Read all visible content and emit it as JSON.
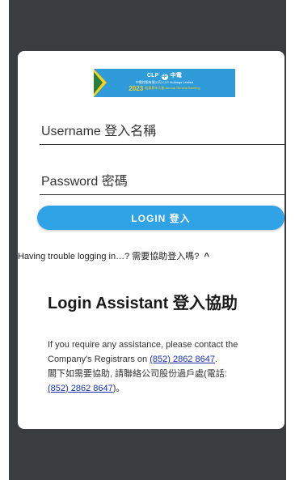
{
  "banner": {
    "brand": "CLP",
    "brand_symbol": "中",
    "brand_cn": "中電",
    "subtitle": "中電控股有限公司 CLP Holdings Limited",
    "year": "2023",
    "meeting": "股東周年大會 Annual General Meeting"
  },
  "form": {
    "username_placeholder": "Username 登入名稱",
    "password_placeholder": "Password 密碼",
    "login_label": "LOGIN 登入"
  },
  "help": {
    "trouble_text": "Having trouble logging in…? 需要協助登入嗎?",
    "toggle_icon": "chevron-up-icon",
    "toggle_glyph": "^"
  },
  "assistant": {
    "title": "Login Assistant 登入協助",
    "text_en": "If you require any assistance, please contact the Company's Registrars on ",
    "phone": "(852) 2862 8647",
    "text_en_end": ".",
    "text_cn": "閣下如需要協助, 請聯絡公司股份過戶處(電話: ",
    "text_cn_end": ")。"
  },
  "colors": {
    "background": "#3a3d3e",
    "button": "#2fa3e6",
    "link": "#1a2fb0"
  }
}
